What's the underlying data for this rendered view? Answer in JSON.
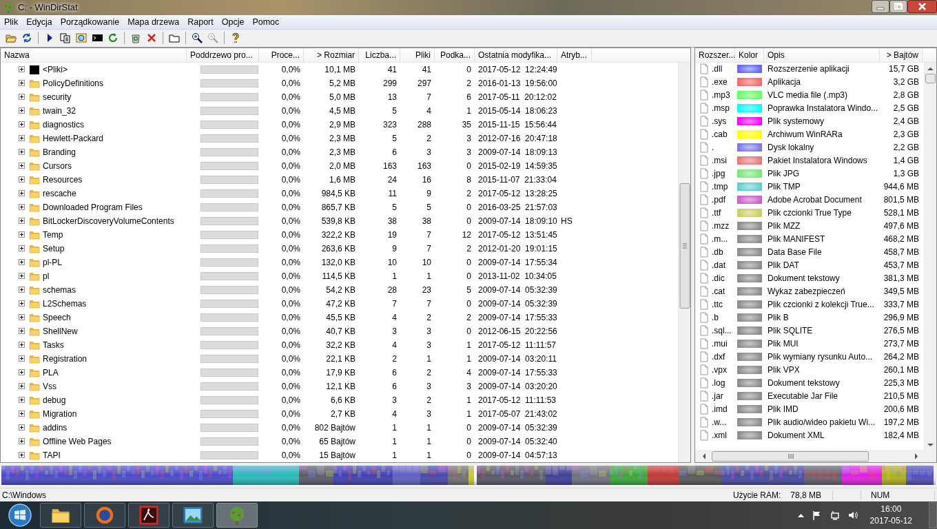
{
  "window": {
    "title": "C: - WinDirStat"
  },
  "menu": [
    "Plik",
    "Edycja",
    "Porządkowanie",
    "Mapa drzewa",
    "Raport",
    "Opcje",
    "Pomoc"
  ],
  "directory_list": {
    "columns": [
      "Nazwa",
      "Poddrzewo pro...",
      "Proce...",
      "> Rozmiar",
      "Liczba...",
      "Pliki",
      "Podka...",
      "Ostatnia modyfika...",
      "Atryb..."
    ],
    "rows": [
      {
        "kind": "files",
        "name": "<Pliki>",
        "expanded": false,
        "level": 0,
        "percent": "0,0%",
        "size": "10,1 MB",
        "items": "41",
        "files": "41",
        "subdirs": "0",
        "modified": "2017-05-12  12:24:49"
      },
      {
        "kind": "folder",
        "name": "PolicyDefinitions",
        "expanded": false,
        "level": 0,
        "percent": "0,0%",
        "size": "5,2 MB",
        "items": "299",
        "files": "297",
        "subdirs": "2",
        "modified": "2016-01-13  19:56:00"
      },
      {
        "kind": "folder",
        "name": "security",
        "expanded": false,
        "level": 0,
        "percent": "0,0%",
        "size": "5,0 MB",
        "items": "13",
        "files": "7",
        "subdirs": "6",
        "modified": "2017-05-11  20:12:02"
      },
      {
        "kind": "folder",
        "name": "twain_32",
        "expanded": false,
        "level": 0,
        "percent": "0,0%",
        "size": "4,5 MB",
        "items": "5",
        "files": "4",
        "subdirs": "1",
        "modified": "2015-05-14  18:06:23"
      },
      {
        "kind": "folder",
        "name": "diagnostics",
        "expanded": false,
        "level": 0,
        "percent": "0,0%",
        "size": "2,9 MB",
        "items": "323",
        "files": "288",
        "subdirs": "35",
        "modified": "2015-11-15  15:56:44"
      },
      {
        "kind": "folder",
        "name": "Hewlett-Packard",
        "expanded": false,
        "level": 0,
        "percent": "0,0%",
        "size": "2,3 MB",
        "items": "5",
        "files": "2",
        "subdirs": "3",
        "modified": "2012-07-16  20:47:18"
      },
      {
        "kind": "folder",
        "name": "Branding",
        "expanded": false,
        "level": 0,
        "percent": "0,0%",
        "size": "2,3 MB",
        "items": "6",
        "files": "3",
        "subdirs": "3",
        "modified": "2009-07-14  18:09:13"
      },
      {
        "kind": "folder",
        "name": "Cursors",
        "expanded": false,
        "level": 0,
        "percent": "0,0%",
        "size": "2,0 MB",
        "items": "163",
        "files": "163",
        "subdirs": "0",
        "modified": "2015-02-19  14:59:35"
      },
      {
        "kind": "folder",
        "name": "Resources",
        "expanded": false,
        "level": 0,
        "percent": "0,0%",
        "size": "1,6 MB",
        "items": "24",
        "files": "16",
        "subdirs": "8",
        "modified": "2015-11-07  21:33:04"
      },
      {
        "kind": "folder",
        "name": "rescache",
        "expanded": false,
        "level": 0,
        "percent": "0,0%",
        "size": "984,5 KB",
        "items": "11",
        "files": "9",
        "subdirs": "2",
        "modified": "2017-05-12  13:28:25"
      },
      {
        "kind": "folder",
        "name": "Downloaded Program Files",
        "expanded": false,
        "level": 0,
        "percent": "0,0%",
        "size": "865,7 KB",
        "items": "5",
        "files": "5",
        "subdirs": "0",
        "modified": "2016-03-25  21:57:03"
      },
      {
        "kind": "folder",
        "name": "BitLockerDiscoveryVolumeContents",
        "expanded": false,
        "level": 0,
        "percent": "0,0%",
        "size": "539,8 KB",
        "items": "38",
        "files": "38",
        "subdirs": "0",
        "modified": "2009-07-14  18:09:10",
        "attributes": "HS"
      },
      {
        "kind": "folder",
        "name": "Temp",
        "expanded": false,
        "level": 0,
        "percent": "0,0%",
        "size": "322,2 KB",
        "items": "19",
        "files": "7",
        "subdirs": "12",
        "modified": "2017-05-12  13:51:45"
      },
      {
        "kind": "folder",
        "name": "Setup",
        "expanded": false,
        "level": 0,
        "percent": "0,0%",
        "size": "263,6 KB",
        "items": "9",
        "files": "7",
        "subdirs": "2",
        "modified": "2012-01-20  19:01:15"
      },
      {
        "kind": "folder",
        "name": "pl-PL",
        "expanded": false,
        "level": 0,
        "percent": "0,0%",
        "size": "132,0 KB",
        "items": "10",
        "files": "10",
        "subdirs": "0",
        "modified": "2009-07-14  17:55:34"
      },
      {
        "kind": "folder",
        "name": "pl",
        "expanded": false,
        "level": 0,
        "percent": "0,0%",
        "size": "114,5 KB",
        "items": "1",
        "files": "1",
        "subdirs": "0",
        "modified": "2013-11-02  10:34:05"
      },
      {
        "kind": "folder",
        "name": "schemas",
        "expanded": false,
        "level": 0,
        "percent": "0,0%",
        "size": "54,2 KB",
        "items": "28",
        "files": "23",
        "subdirs": "5",
        "modified": "2009-07-14  05:32:39"
      },
      {
        "kind": "folder",
        "name": "L2Schemas",
        "expanded": false,
        "level": 0,
        "percent": "0,0%",
        "size": "47,2 KB",
        "items": "7",
        "files": "7",
        "subdirs": "0",
        "modified": "2009-07-14  05:32:39"
      },
      {
        "kind": "folder",
        "name": "Speech",
        "expanded": false,
        "level": 0,
        "percent": "0,0%",
        "size": "45,5 KB",
        "items": "4",
        "files": "2",
        "subdirs": "2",
        "modified": "2009-07-14  17:55:33"
      },
      {
        "kind": "folder",
        "name": "ShellNew",
        "expanded": false,
        "level": 0,
        "percent": "0,0%",
        "size": "40,7 KB",
        "items": "3",
        "files": "3",
        "subdirs": "0",
        "modified": "2012-06-15  20:22:56"
      },
      {
        "kind": "folder",
        "name": "Tasks",
        "expanded": false,
        "level": 0,
        "percent": "0,0%",
        "size": "32,2 KB",
        "items": "4",
        "files": "3",
        "subdirs": "1",
        "modified": "2017-05-12  11:11:57"
      },
      {
        "kind": "folder",
        "name": "Registration",
        "expanded": false,
        "level": 0,
        "percent": "0,0%",
        "size": "22,1 KB",
        "items": "2",
        "files": "1",
        "subdirs": "1",
        "modified": "2009-07-14  03:20:11"
      },
      {
        "kind": "folder",
        "name": "PLA",
        "expanded": false,
        "level": 0,
        "percent": "0,0%",
        "size": "17,9 KB",
        "items": "6",
        "files": "2",
        "subdirs": "4",
        "modified": "2009-07-14  17:55:33"
      },
      {
        "kind": "folder",
        "name": "Vss",
        "expanded": false,
        "level": 0,
        "percent": "0,0%",
        "size": "12,1 KB",
        "items": "6",
        "files": "3",
        "subdirs": "3",
        "modified": "2009-07-14  03:20:20"
      },
      {
        "kind": "folder",
        "name": "debug",
        "expanded": false,
        "level": 0,
        "percent": "0,0%",
        "size": "6,6 KB",
        "items": "3",
        "files": "2",
        "subdirs": "1",
        "modified": "2017-05-12  11:11:53"
      },
      {
        "kind": "folder",
        "name": "Migration",
        "expanded": false,
        "level": 0,
        "percent": "0,0%",
        "size": "2,7 KB",
        "items": "4",
        "files": "3",
        "subdirs": "1",
        "modified": "2017-05-07  21:43:02"
      },
      {
        "kind": "folder",
        "name": "addins",
        "expanded": false,
        "level": 0,
        "percent": "0,0%",
        "size": "802 Bajtów",
        "items": "1",
        "files": "1",
        "subdirs": "0",
        "modified": "2009-07-14  05:32:39"
      },
      {
        "kind": "folder",
        "name": "Offline Web Pages",
        "expanded": false,
        "level": 0,
        "percent": "0,0%",
        "size": "65 Bajtów",
        "items": "1",
        "files": "1",
        "subdirs": "0",
        "modified": "2009-07-14  05:32:40"
      },
      {
        "kind": "folder",
        "name": "TAPI",
        "expanded": false,
        "level": 0,
        "percent": "0,0%",
        "size": "15 Bajtów",
        "items": "1",
        "files": "1",
        "subdirs": "0",
        "modified": "2009-07-14  04:57:13"
      }
    ]
  },
  "extension_list": {
    "columns": [
      "Rozszer...",
      "Kolor",
      "Opis",
      "> Bajtów"
    ],
    "rows": [
      {
        "extension": ".dll",
        "color": "#6464ff",
        "description": "Rozszerzenie aplikacji",
        "bytes": "15,7 GB"
      },
      {
        "extension": ".exe",
        "color": "#ff6464",
        "description": "Aplikacja",
        "bytes": "3,2 GB"
      },
      {
        "extension": ".mp3",
        "color": "#64ff64",
        "description": "VLC media file (.mp3)",
        "bytes": "2,8 GB"
      },
      {
        "extension": ".msp",
        "color": "#00ffff",
        "description": "Poprawka Instalatora Windo...",
        "bytes": "2,5 GB"
      },
      {
        "extension": ".sys",
        "color": "#ff00ff",
        "description": "Plik systemowy",
        "bytes": "2,4 GB"
      },
      {
        "extension": ".cab",
        "color": "#ffff00",
        "description": "Archiwum WinRARa",
        "bytes": "2,3 GB"
      },
      {
        "extension": ".",
        "color": "#7878e6",
        "description": "Dysk lokalny",
        "bytes": "2,2 GB"
      },
      {
        "extension": ".msi",
        "color": "#e67878",
        "description": "Pakiet Instalatora Windows",
        "bytes": "1,4 GB"
      },
      {
        "extension": ".jpg",
        "color": "#78e678",
        "description": "Plik JPG",
        "bytes": "1,3 GB"
      },
      {
        "extension": ".tmp",
        "color": "#5ecdcd",
        "description": "Plik TMP",
        "bytes": "944,6 MB"
      },
      {
        "extension": ".pdf",
        "color": "#cd5ecd",
        "description": "Adobe Acrobat Document",
        "bytes": "801,5 MB"
      },
      {
        "extension": ".ttf",
        "color": "#cdcd5e",
        "description": "Plik czcionki True Type",
        "bytes": "528,1 MB"
      },
      {
        "extension": ".mzz",
        "color": "#8c8c8c",
        "description": "Plik MZZ",
        "bytes": "497,6 MB"
      },
      {
        "extension": ".m...",
        "color": "#8c8c8c",
        "description": "Plik MANIFEST",
        "bytes": "468,2 MB"
      },
      {
        "extension": ".db",
        "color": "#8c8c8c",
        "description": "Data Base File",
        "bytes": "458,7 MB"
      },
      {
        "extension": ".dat",
        "color": "#8c8c8c",
        "description": "Plik DAT",
        "bytes": "453,7 MB"
      },
      {
        "extension": ".dic",
        "color": "#8c8c8c",
        "description": "Dokument tekstowy",
        "bytes": "381,3 MB"
      },
      {
        "extension": ".cat",
        "color": "#8c8c8c",
        "description": "Wykaz zabezpieczeń",
        "bytes": "349,5 MB"
      },
      {
        "extension": ".ttc",
        "color": "#8c8c8c",
        "description": "Plik czcionki z kolekcji True...",
        "bytes": "333,7 MB"
      },
      {
        "extension": ".b",
        "color": "#8c8c8c",
        "description": "Plik B",
        "bytes": "296,9 MB"
      },
      {
        "extension": ".sql...",
        "color": "#8c8c8c",
        "description": "Plik SQLITE",
        "bytes": "276,5 MB"
      },
      {
        "extension": ".mui",
        "color": "#8c8c8c",
        "description": "Plik MUI",
        "bytes": "273,7 MB"
      },
      {
        "extension": ".dxf",
        "color": "#8c8c8c",
        "description": "Plik wymiany rysunku Auto...",
        "bytes": "264,2 MB"
      },
      {
        "extension": ".vpx",
        "color": "#8c8c8c",
        "description": "Plik VPX",
        "bytes": "260,1 MB"
      },
      {
        "extension": ".log",
        "color": "#8c8c8c",
        "description": "Dokument tekstowy",
        "bytes": "225,3 MB"
      },
      {
        "extension": ".jar",
        "color": "#8c8c8c",
        "description": "Executable Jar File",
        "bytes": "210,5 MB"
      },
      {
        "extension": ".imd",
        "color": "#8c8c8c",
        "description": "Plik IMD",
        "bytes": "200,6 MB"
      },
      {
        "extension": ".w...",
        "color": "#8c8c8c",
        "description": "Plik audio/wideo pakietu Wi...",
        "bytes": "197,2 MB"
      },
      {
        "extension": ".xml",
        "color": "#8c8c8c",
        "description": "Dokument XML",
        "bytes": "182,4 MB"
      }
    ]
  },
  "status_bar": {
    "path": "C:\\Windows",
    "ram_label": "Użycie RAM:",
    "ram_value": "78,8 MB",
    "num_lock": "NUM"
  },
  "taskbar": {
    "time": "16:00",
    "date": "2017-05-12"
  }
}
